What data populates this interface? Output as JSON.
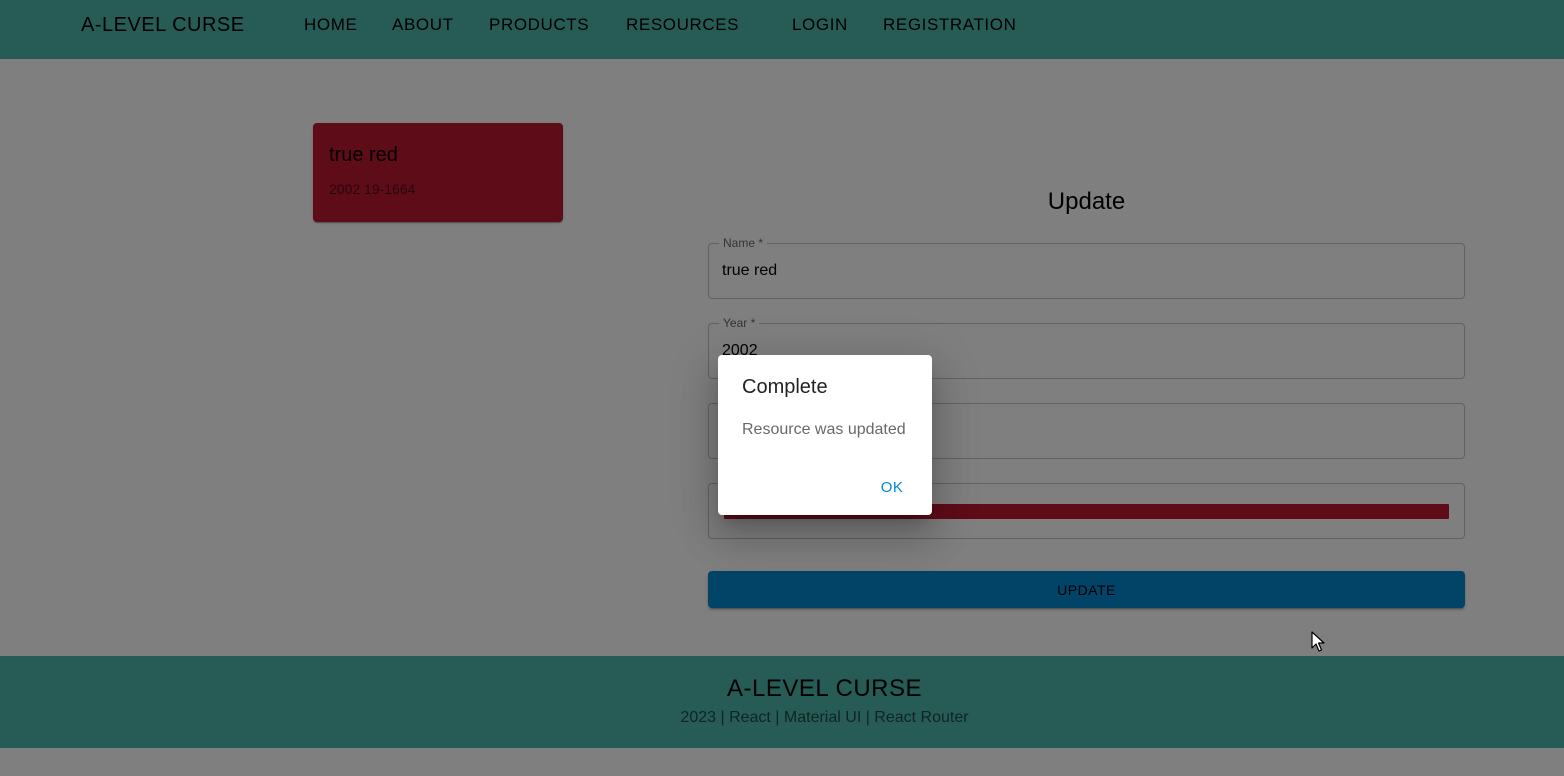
{
  "header": {
    "brand": "A-LEVEL CURSE",
    "nav": [
      "HOME",
      "ABOUT",
      "PRODUCTS",
      "RESOURCES",
      "LOGIN",
      "REGISTRATION"
    ]
  },
  "card": {
    "title": "true red",
    "subtitle": "2002 19-1664",
    "color": "#bf1932"
  },
  "form": {
    "title": "Update",
    "name_label": "Name *",
    "name_value": "true red",
    "year_label": "Year *",
    "year_value": "2002",
    "color_value": "#bf1932",
    "submit_label": "UPDATE"
  },
  "dialog": {
    "title": "Complete",
    "message": "Resource was updated",
    "ok_label": "OK"
  },
  "footer": {
    "brand": "A-LEVEL CURSE",
    "subtitle": "2023 | React | Material UI | React Router"
  },
  "colors": {
    "header_bg": "#4db6ac",
    "primary": "#0288d1",
    "swatch": "#bf1932"
  }
}
